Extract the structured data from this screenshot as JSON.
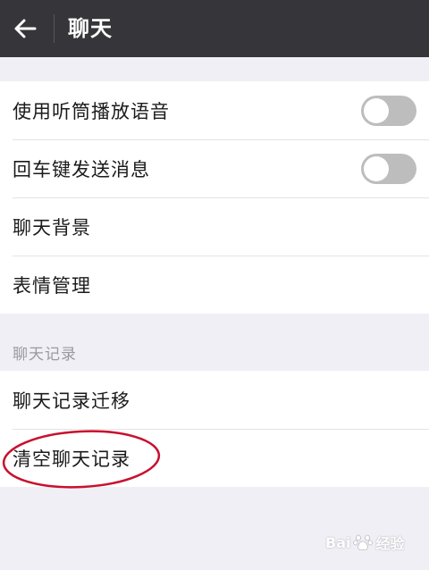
{
  "header": {
    "title": "聊天"
  },
  "settings_group": {
    "items": [
      {
        "label": "使用听筒播放语音",
        "toggle": {
          "enabled": false
        }
      },
      {
        "label": "回车键发送消息",
        "toggle": {
          "enabled": false
        }
      },
      {
        "label": "聊天背景"
      },
      {
        "label": "表情管理"
      }
    ]
  },
  "chat_history": {
    "section_title": "聊天记录",
    "items": [
      {
        "label": "聊天记录迁移"
      },
      {
        "label": "清空聊天记录"
      }
    ]
  },
  "watermark": {
    "left": "Bai",
    "right": "经验"
  },
  "colors": {
    "topbar": "#36363a",
    "background": "#f0eff5",
    "toggle_off": "#bdbdbd",
    "annotation": "#c8102e"
  },
  "icons": [
    "back-arrow-icon",
    "baidu-paw-icon"
  ]
}
